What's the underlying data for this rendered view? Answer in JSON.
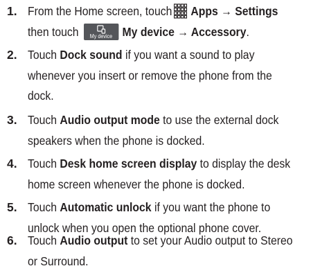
{
  "steps": [
    {
      "number": "1.",
      "line1": {
        "pre": "From the Home screen, touch",
        "apps_label": "Apps → Settings"
      },
      "line2": {
        "pre": "then touch",
        "icon_caption": "My device",
        "target": "My device → Accessory",
        "post": "."
      },
      "icons": [
        "apps-grid-icon",
        "my-device-icon"
      ]
    },
    {
      "number": "2.",
      "pre": "Touch",
      "bold": "Dock sound",
      "lines": [
        "if you want a sound to play",
        "whenever you insert or remove the phone from the",
        "dock."
      ]
    },
    {
      "number": "3.",
      "pre": "Touch",
      "bold": "Audio output mode",
      "lines": [
        "to use the external dock",
        "speakers when the phone is docked."
      ]
    },
    {
      "number": "4.",
      "pre": "Touch",
      "bold": "Desk home screen display",
      "lines": [
        "to display the desk",
        "home screen whenever the phone is docked."
      ]
    },
    {
      "number": "5.",
      "pre": "Touch",
      "bold": "Automatic unlock",
      "lines": [
        "if you want the phone to",
        "unlock when you open the optional phone cover."
      ]
    },
    {
      "number": "6.",
      "pre": "Touch",
      "bold": "Audio output",
      "lines": [
        "to set your Audio output to Stereo",
        "or Surround."
      ]
    }
  ],
  "colors": {
    "text": "#231f20",
    "icon_background": "#54565a"
  }
}
